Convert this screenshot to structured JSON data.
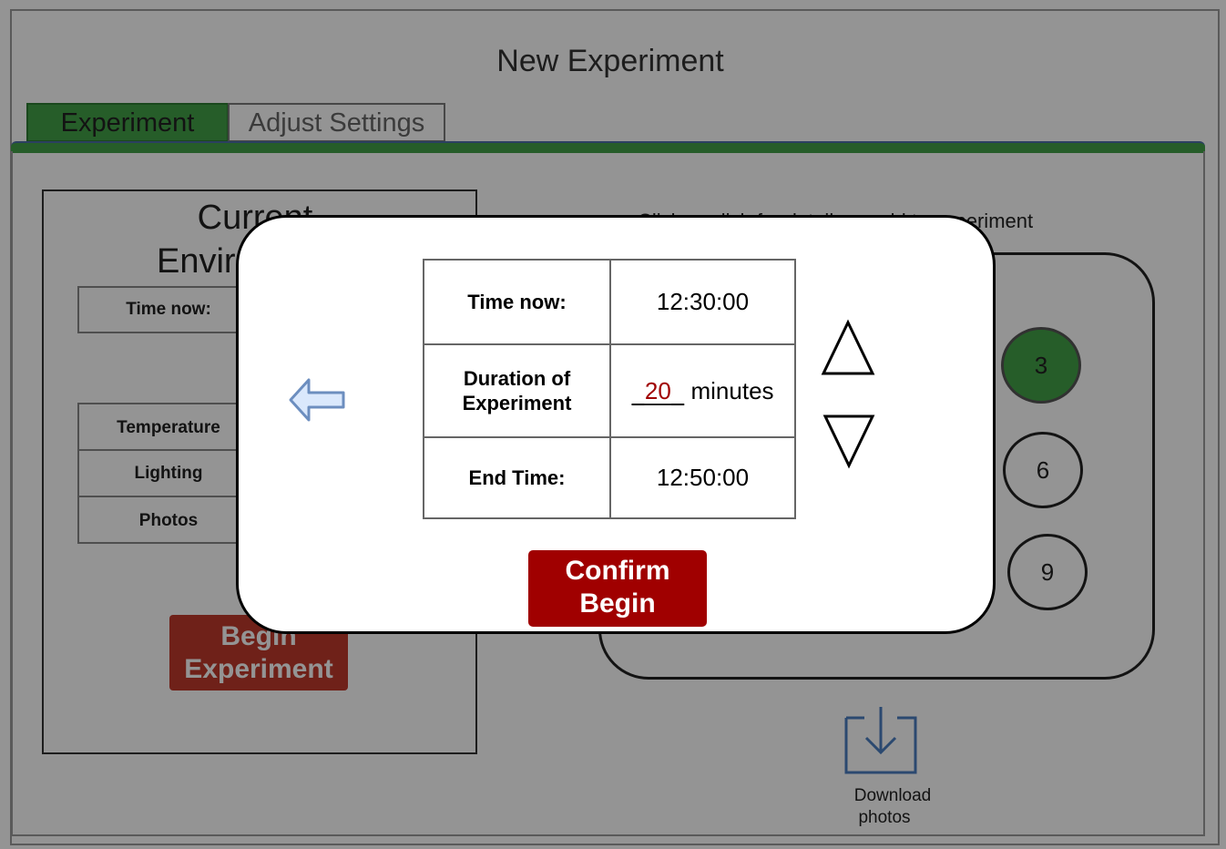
{
  "page": {
    "title": "New Experiment"
  },
  "tabs": [
    {
      "label": "Experiment",
      "active": true
    },
    {
      "label": "Adjust Settings",
      "active": false
    }
  ],
  "environment": {
    "title_line1": "Current",
    "title_line2": "Envir",
    "time_label": "Time now:",
    "rows": [
      "Temperature",
      "Lighting",
      "Photos"
    ],
    "begin_button": {
      "line1": "Begin",
      "line2": "Experiment"
    }
  },
  "plate": {
    "hint": "Click on dish for details or add to experiment",
    "wells": [
      "3",
      "6",
      "9"
    ],
    "selected_well": "3"
  },
  "download": {
    "line1": "Download",
    "line2": "photos"
  },
  "modal": {
    "time_now_label": "Time now:",
    "time_now_value": "12:30:00",
    "duration_label_line1": "Duration of",
    "duration_label_line2": "Experiment",
    "duration_value": "20",
    "duration_unit": "minutes",
    "end_time_label": "End Time:",
    "end_time_value": "12:50:00",
    "confirm_button": {
      "line1": "Confirm",
      "line2": "Begin"
    }
  },
  "colors": {
    "accent_green": "#43a047",
    "confirm_red": "#a00000",
    "begin_red": "#c0392b",
    "arrow_blue": "#6c8ebf"
  },
  "icons": [
    "back-arrow-icon",
    "up-triangle-icon",
    "down-triangle-icon",
    "download-icon"
  ]
}
